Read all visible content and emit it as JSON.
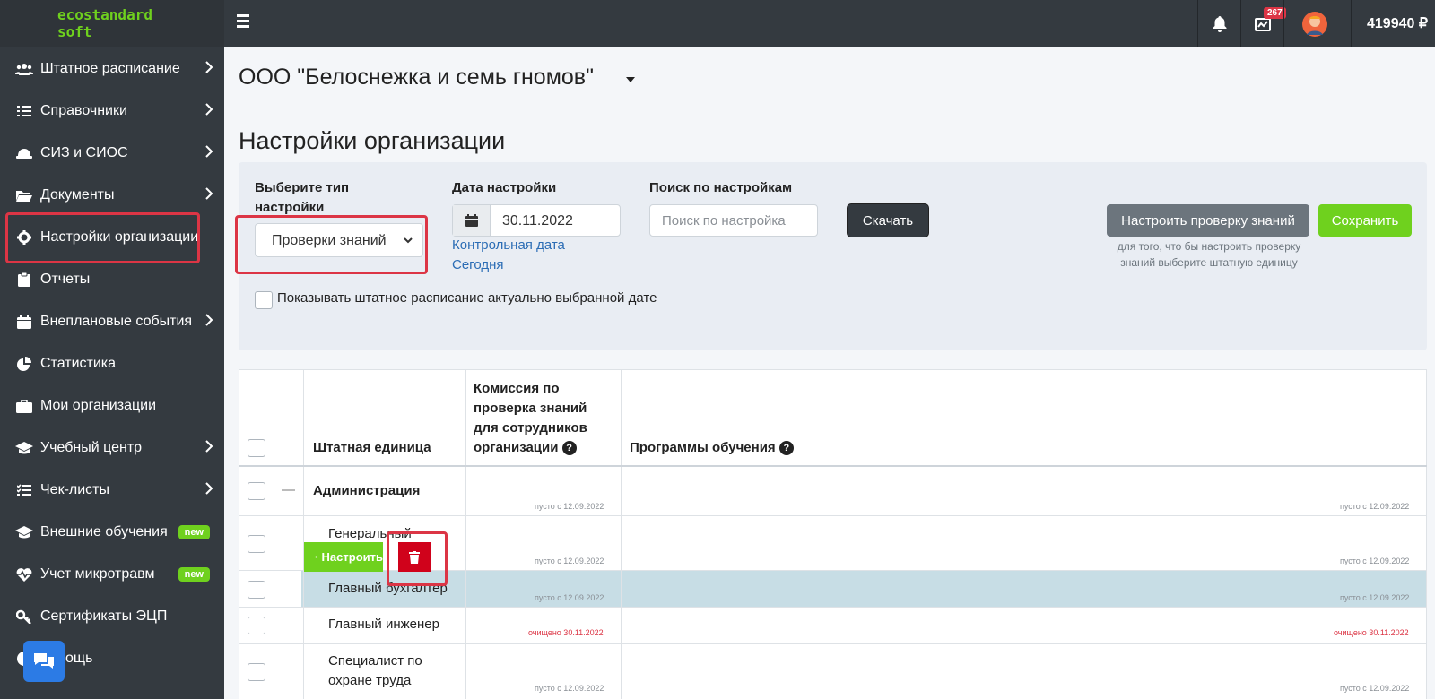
{
  "brand": {
    "line1": "ecostandard",
    "line2": "soft"
  },
  "header": {
    "notification_count": "267",
    "balance": "419940 ₽",
    "icons": [
      "bell-icon",
      "chart-icon",
      "avatar"
    ]
  },
  "sidebar": {
    "items": [
      {
        "label": "Штатное расписание",
        "icon": "users-icon",
        "has_chevron": true
      },
      {
        "label": "Справочники",
        "icon": "list-icon",
        "has_chevron": true
      },
      {
        "label": "СИЗ и СИОС",
        "icon": "helmet-icon",
        "has_chevron": true
      },
      {
        "label": "Документы",
        "icon": "folder-icon",
        "has_chevron": true
      },
      {
        "label": "Настройки организации",
        "icon": "gear-icon",
        "has_chevron": false,
        "highlighted": true
      },
      {
        "label": "Отчеты",
        "icon": "clipboard-icon",
        "has_chevron": false
      },
      {
        "label": "Внеплановые события",
        "icon": "calendar-icon",
        "has_chevron": true
      },
      {
        "label": "Статистика",
        "icon": "pie-chart-icon",
        "has_chevron": false
      },
      {
        "label": "Мои организации",
        "icon": "briefcase-icon",
        "has_chevron": false
      },
      {
        "label": "Учебный центр",
        "icon": "graduation-cap-icon",
        "has_chevron": true
      },
      {
        "label": "Чек-листы",
        "icon": "checklist-icon",
        "has_chevron": true
      },
      {
        "label": "Внешние обучения",
        "icon": "graduation-cap-icon",
        "badge": "new"
      },
      {
        "label": "Учет микротравм",
        "icon": "heartbeat-icon",
        "badge": "new"
      },
      {
        "label": "Сертификаты ЭЦП",
        "icon": "key-icon",
        "has_chevron": false
      },
      {
        "label": "ощь",
        "icon": "info-icon",
        "has_chevron": false
      }
    ]
  },
  "main": {
    "org_name": "ООО \"Белоснежка и семь гномов\"",
    "page_title": "Настройки организации"
  },
  "filters": {
    "type_label": "Выберите тип настройки",
    "type_value": "Проверки знаний",
    "date_label": "Дата настройки",
    "date_value": "30.11.2022",
    "control_date_link": "Контрольная дата",
    "today_link": "Сегодня",
    "search_label": "Поиск по настройкам",
    "search_placeholder": "Поиск по настройка",
    "download_button": "Скачать",
    "configure_button": "Настроить проверку знаний",
    "save_button": "Сохранить",
    "configure_hint": "для того, что бы настроить проверку знаний выберите штатную единицу",
    "show_schedule_label": "Показывать штатное расписание актуально выбранной дате"
  },
  "table": {
    "headers": {
      "unit": "Штатная единица",
      "commission": "Комиссия по проверка знаний для сотрудников организации",
      "programs": "Программы обучения"
    },
    "rows": [
      {
        "name": "Администрация",
        "collapse": "—",
        "commission_note": "пусто с 12.09.2022",
        "programs_note": "пусто с 12.09.2022",
        "bold": true
      },
      {
        "name": "Генеральный",
        "commission_note": "пусто с 12.09.2022",
        "programs_note": "пусто с 12.09.2022"
      },
      {
        "name": "Главный бухгалтер",
        "commission_note": "пусто с 12.09.2022",
        "programs_note": "пусто с 12.09.2022",
        "selected": true
      },
      {
        "name": "Главный инженер",
        "commission_note": "очищено 30.11.2022",
        "programs_note": "очищено 30.11.2022",
        "cleared": true
      },
      {
        "name": "Специалист по охране труда",
        "commission_note": "пусто с 12.09.2022",
        "programs_note": "пусто с 12.09.2022"
      }
    ],
    "row_action_label": "Настроить"
  },
  "colors": {
    "accent_green": "#6fd11e",
    "dark_bg": "#343a40",
    "danger_red": "#dc3545",
    "link_blue": "#2c6db5"
  }
}
